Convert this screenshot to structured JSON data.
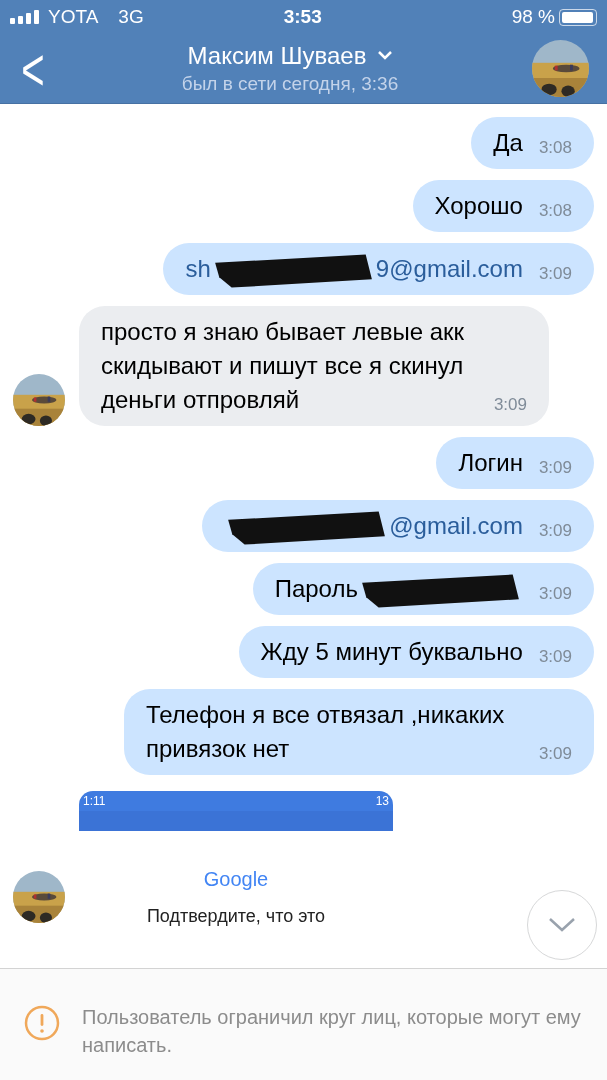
{
  "status_bar": {
    "carrier": "YOTA",
    "network": "3G",
    "time": "3:53",
    "battery": "98 %"
  },
  "header": {
    "back": "<",
    "title": "Максим Шуваев",
    "subtitle": "был в сети сегодня, 3:36"
  },
  "messages": [
    {
      "kind": "sent",
      "text": "Да",
      "redacted": false,
      "link": false,
      "time": "3:08"
    },
    {
      "kind": "sent",
      "text": "Хорошо",
      "redacted": false,
      "link": false,
      "time": "3:08"
    },
    {
      "kind": "sent",
      "text": "sh",
      "after": "9@gmail.com",
      "redacted": true,
      "link": true,
      "time": "3:09"
    },
    {
      "kind": "received",
      "text": "просто я знаю бывает левые акк скидывают и пишут все я скинул деньги отпровляй",
      "redacted": false,
      "link": false,
      "time": "3:09"
    },
    {
      "kind": "sent",
      "text": "Логин",
      "redacted": false,
      "link": false,
      "time": "3:09"
    },
    {
      "kind": "sent",
      "after": "@gmail.com",
      "redacted": true,
      "link": true,
      "time": "3:09"
    },
    {
      "kind": "sent",
      "text": "Пароль",
      "redacted": true,
      "link": false,
      "time": "3:09"
    },
    {
      "kind": "sent",
      "text": "Жду 5 минут буквально",
      "redacted": false,
      "link": false,
      "time": "3:09"
    },
    {
      "kind": "sent",
      "text": "Телефон я все отвязал ,никаких привязок нет",
      "redacted": false,
      "link": false,
      "time": "3:09"
    },
    {
      "kind": "received_screenshot",
      "phone_time": "1:11",
      "phone_battery": "13",
      "logo": "Google",
      "caption": "Подтвердите, что это"
    }
  ],
  "notice": {
    "text": "Пользователь ограничил круг лиц, которые могут ему написать."
  }
}
